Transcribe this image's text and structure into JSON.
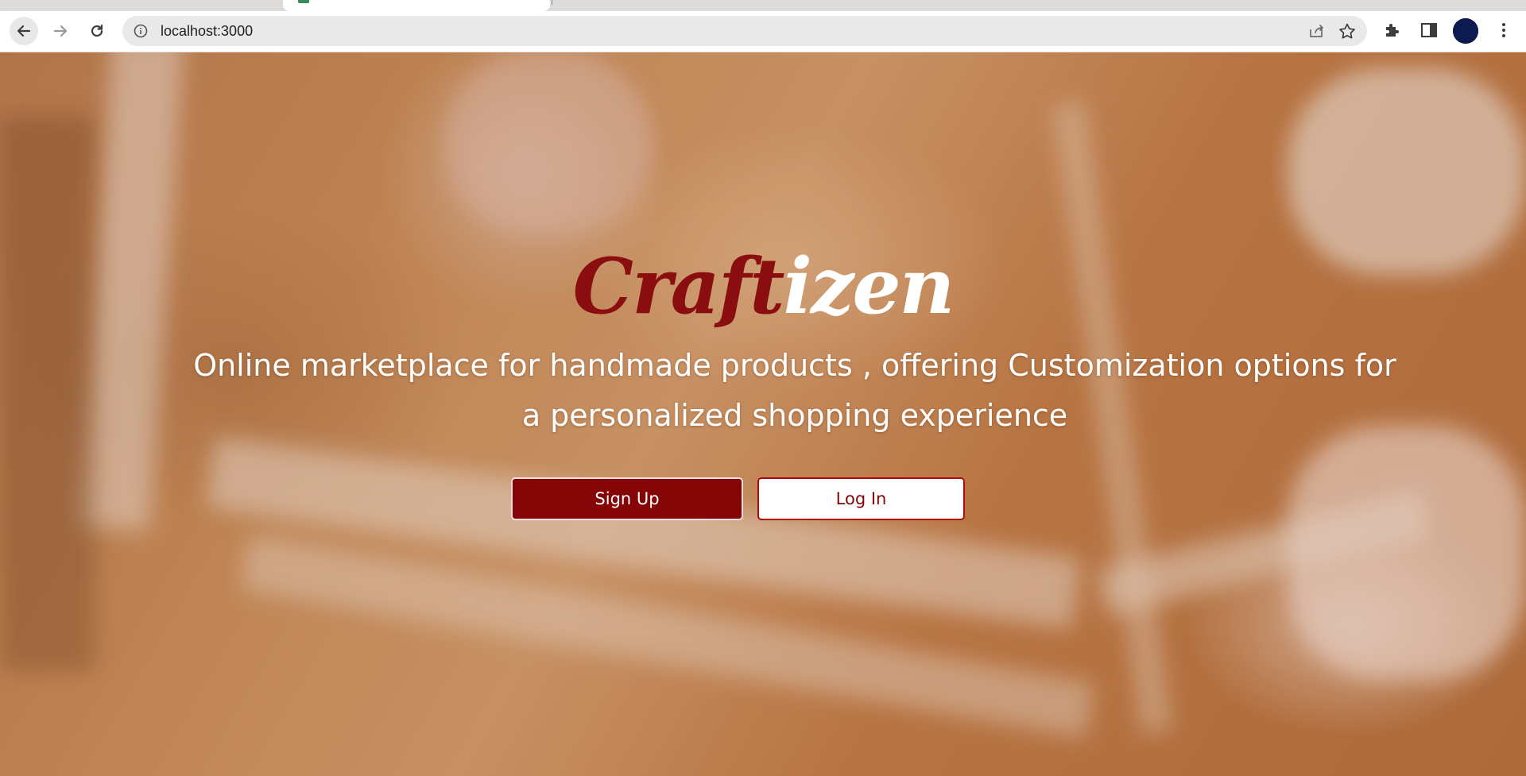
{
  "browser": {
    "url": "localhost:3000",
    "icons": {
      "back": "arrow-left",
      "forward": "arrow-right",
      "reload": "reload",
      "info": "info-circle",
      "share": "share",
      "bookmark": "star",
      "extensions": "puzzle",
      "side_panel": "side-panel",
      "menu": "vertical-dots"
    },
    "avatar_color": "#0b1a4f"
  },
  "hero": {
    "logo_part1": "Craft",
    "logo_part2": "izen",
    "logo_color_primary": "#8a0e10",
    "logo_color_secondary": "#ffffff",
    "tagline": "Online marketplace for handmade products , offering Customization options for a personalized shopping experience",
    "signup_label": "Sign Up",
    "login_label": "Log In",
    "accent_color": "#850507"
  }
}
